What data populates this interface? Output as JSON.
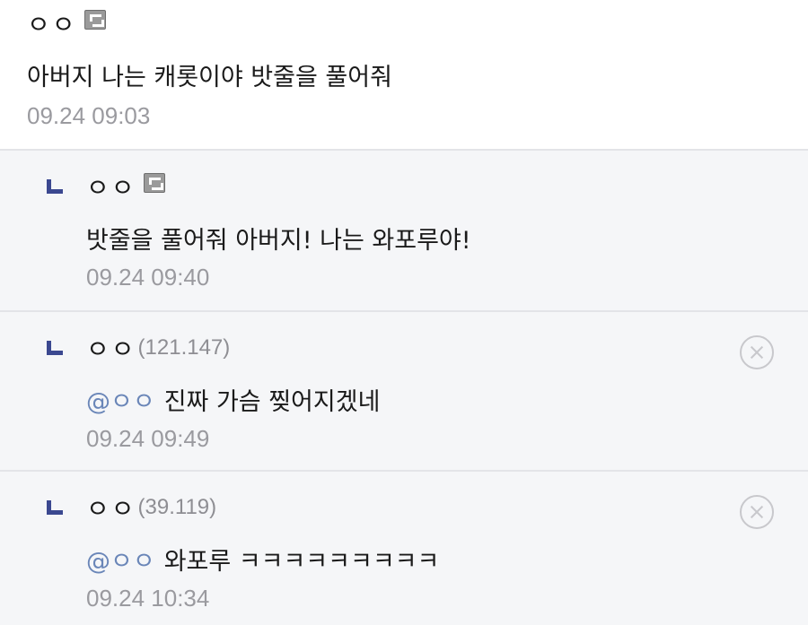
{
  "comments": [
    {
      "nickname": "ㅇㅇ",
      "ip": "",
      "fixed_nick_badge": true,
      "text": "아버지 나는 캐롯이야 밧줄을 풀어줘",
      "mention": "",
      "timestamp": "09.24 09:03"
    },
    {
      "nickname": "ㅇㅇ",
      "ip": "",
      "fixed_nick_badge": true,
      "text": "밧줄을 풀어줘 아버지! 나는 와포루야!",
      "mention": "",
      "timestamp": "09.24 09:40"
    },
    {
      "nickname": "ㅇㅇ",
      "ip": "(121.147)",
      "fixed_nick_badge": false,
      "text": "진짜 가슴 찢어지겠네",
      "mention": "@ㅇㅇ",
      "timestamp": "09.24 09:49"
    },
    {
      "nickname": "ㅇㅇ",
      "ip": "(39.119)",
      "fixed_nick_badge": false,
      "text": "와포루 ㅋㅋㅋㅋㅋㅋㅋㅋㅋ",
      "mention": "@ㅇㅇ",
      "timestamp": "09.24 10:34"
    }
  ],
  "colors": {
    "reply_background": "#f5f6f8",
    "reply_arrow": "#3b4890",
    "mention": "#6a86b8",
    "timestamp": "#9a9a9f"
  },
  "icons": {
    "reply_indicator": "reply-arrow-icon",
    "fixed_nick": "fixed-nick-badge-icon",
    "delete": "delete-circle-x-icon"
  }
}
